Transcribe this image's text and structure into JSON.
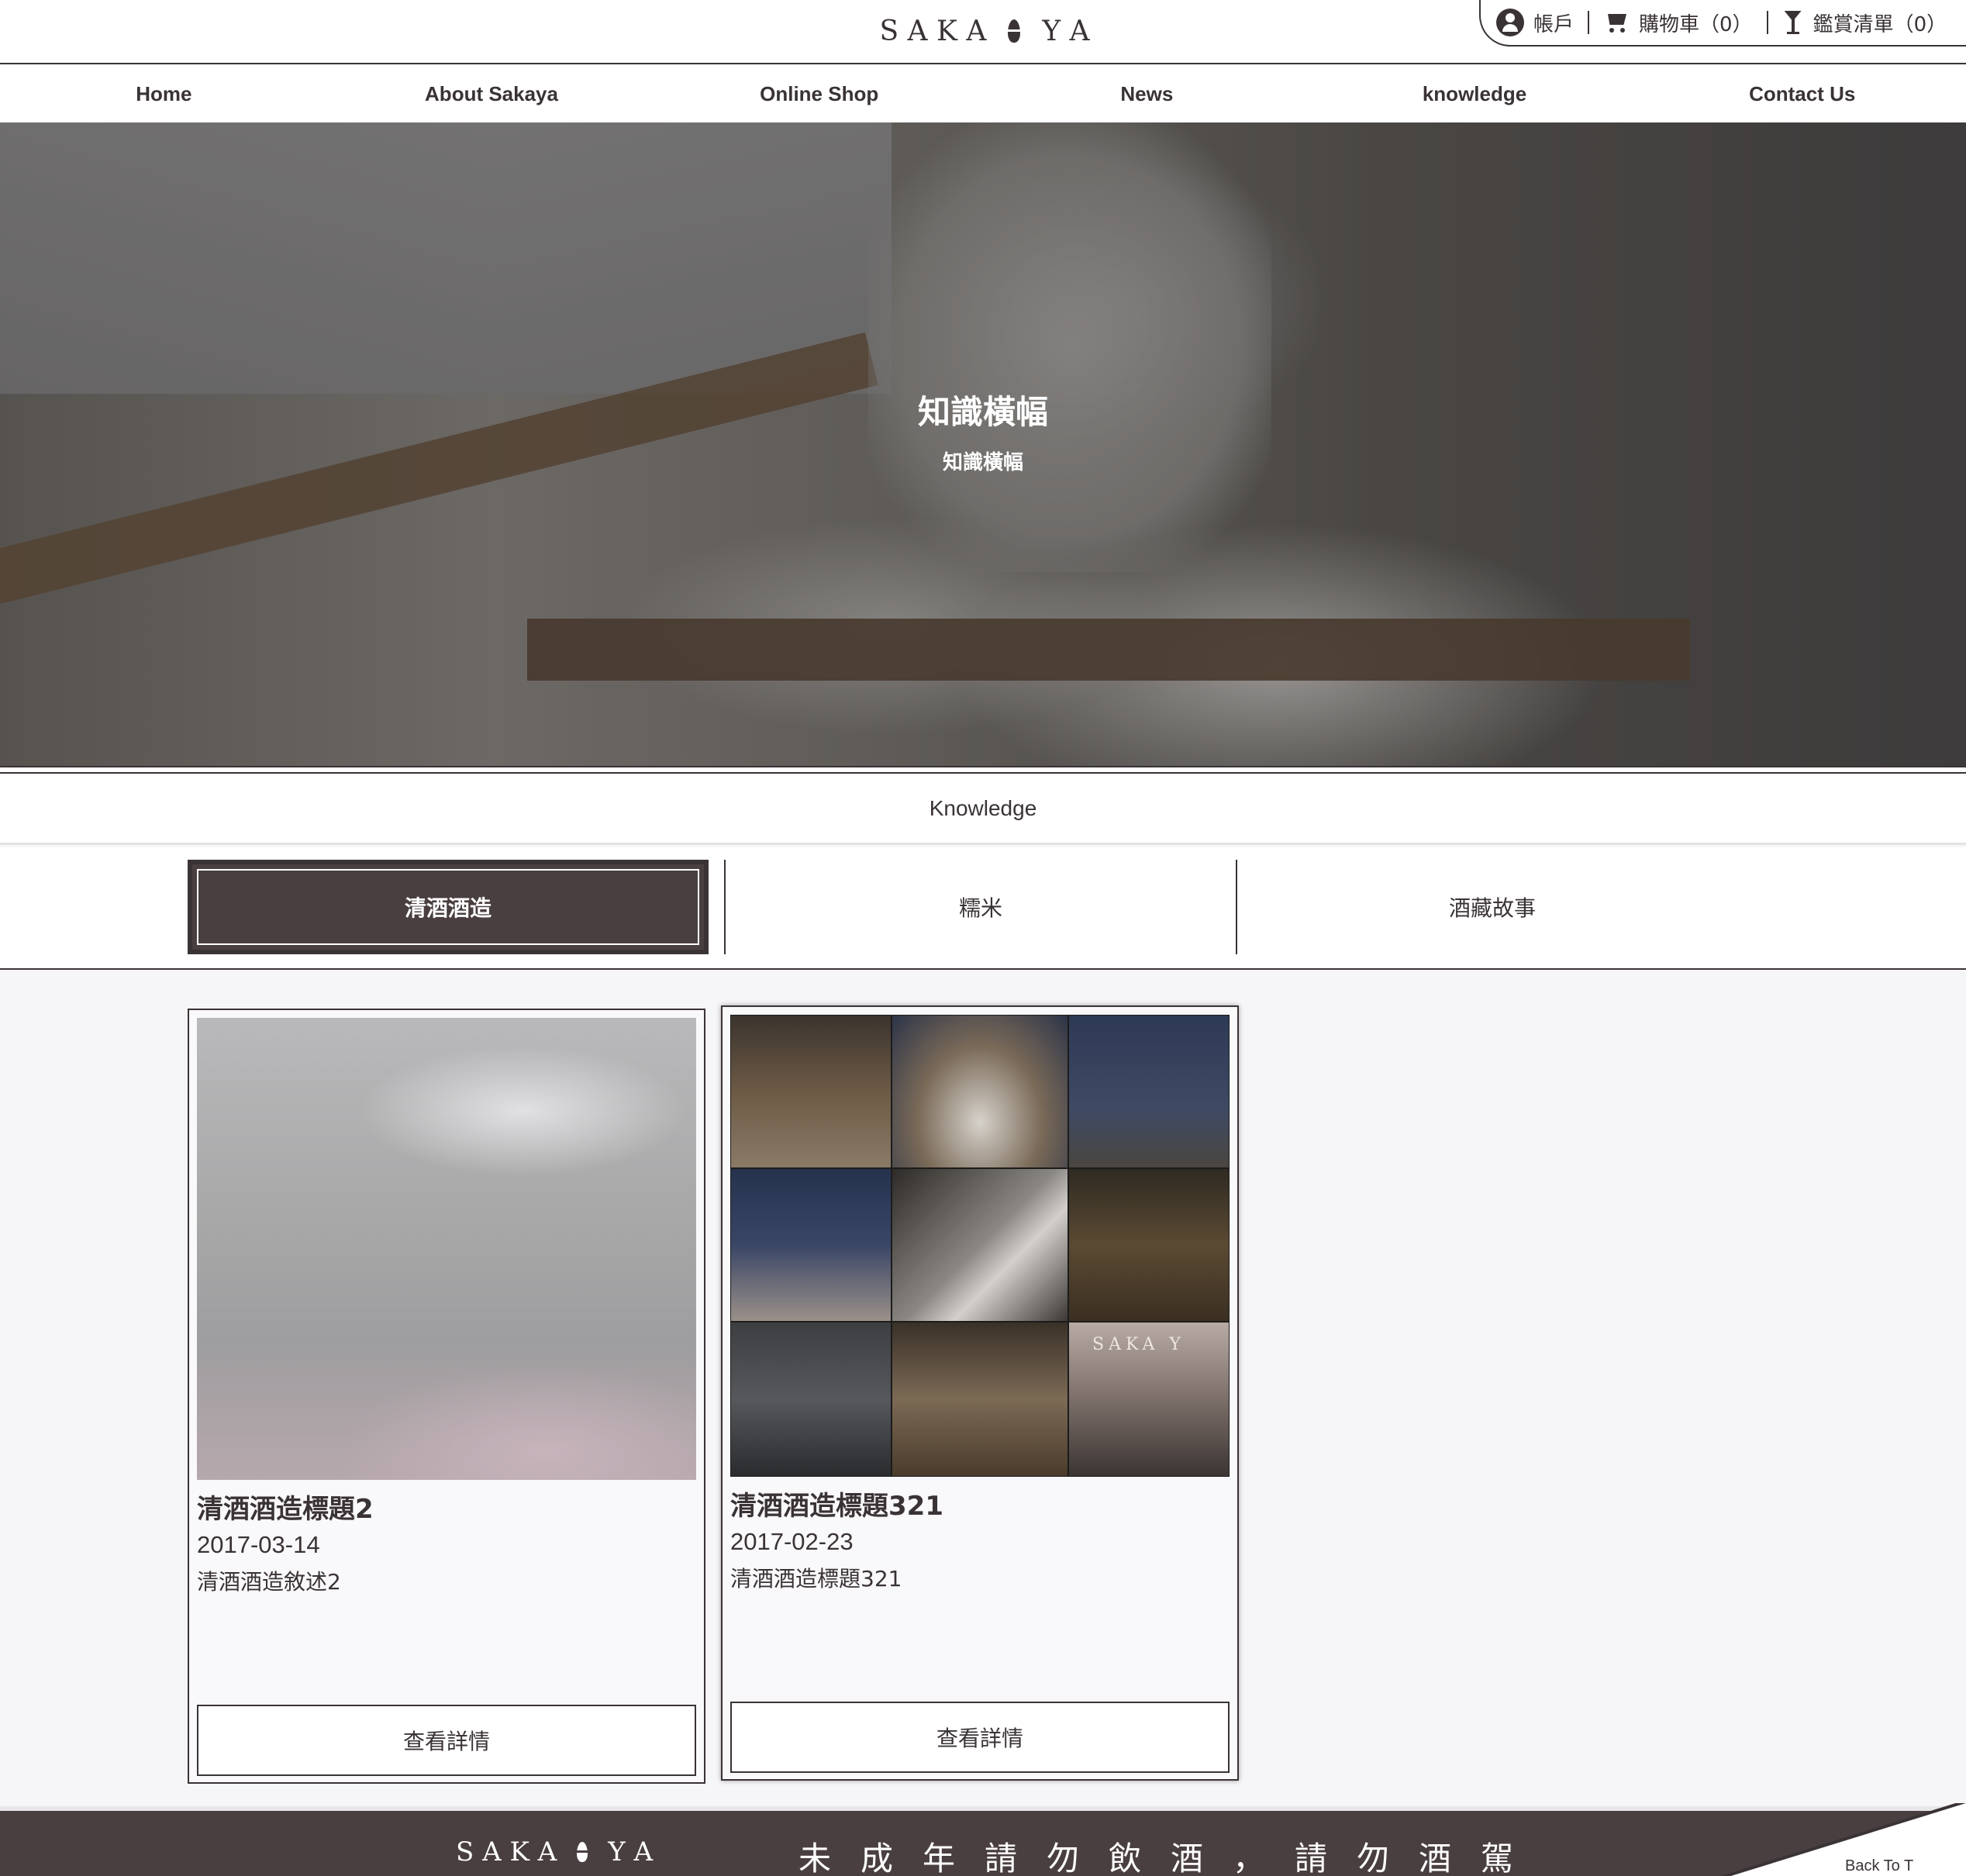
{
  "header": {
    "logo_left": "S A K A",
    "logo_right": "Y A",
    "account_label": "帳戶",
    "cart_label": "購物車（0）",
    "wishlist_label": "鑑賞清單（0）"
  },
  "nav": {
    "items": [
      {
        "label": "Home"
      },
      {
        "label": "About Sakaya"
      },
      {
        "label": "Online Shop"
      },
      {
        "label": "News"
      },
      {
        "label": "knowledge"
      },
      {
        "label": "Contact Us"
      }
    ]
  },
  "hero": {
    "title": "知識橫幅",
    "subtitle": "知識橫幅"
  },
  "section": {
    "title": "Knowledge"
  },
  "tabs": {
    "items": [
      {
        "label": "清酒酒造",
        "active": true
      },
      {
        "label": "糯米",
        "active": false
      },
      {
        "label": "酒藏故事",
        "active": false
      }
    ]
  },
  "cards": [
    {
      "title": "清酒酒造標題2",
      "date": "2017-03-14",
      "description": "清酒酒造敘述2",
      "button_label": "查看詳情"
    },
    {
      "title": "清酒酒造標題321",
      "date": "2017-02-23",
      "description": "清酒酒造標題321",
      "button_label": "查看詳情",
      "image_text": "SAKA Y"
    }
  ],
  "footer": {
    "logo_left": "S A K A",
    "logo_right": "Y A",
    "message": "未成年請勿飲酒，請勿酒駕",
    "back_to_top": "Back To T"
  },
  "colors": {
    "primary": "#3a3335",
    "accent": "#4a3f40",
    "background": "#f6f5f7"
  }
}
